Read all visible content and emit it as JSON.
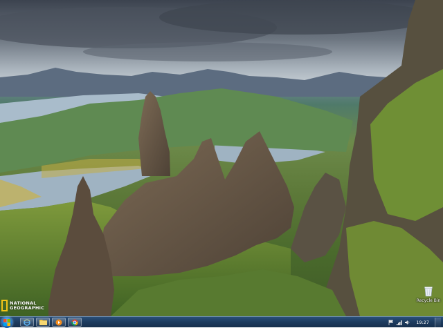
{
  "desktop": {
    "wallpaper": {
      "subject": "rock-pinnacles-landscape",
      "colors": {
        "sky": "#5b6470",
        "loch": "#9fb3c2",
        "grass": "#6d8a3a",
        "rock": "#6a5a48"
      }
    },
    "logo": {
      "line1": "NATIONAL",
      "line2": "GEOGRAPHIC",
      "frame_color": "#f5c518"
    },
    "icons": [
      {
        "label": "Recycle Bin",
        "icon": "recycle-bin-icon"
      }
    ]
  },
  "taskbar": {
    "start_icon": "windows-logo-icon",
    "pinned": [
      {
        "name": "ie",
        "icon": "internet-explorer-icon"
      },
      {
        "name": "explorer",
        "icon": "folder-icon"
      },
      {
        "name": "media",
        "icon": "media-player-icon"
      },
      {
        "name": "chrome",
        "icon": "chrome-icon"
      }
    ],
    "tray": {
      "icons": [
        "flag-icon",
        "network-icon",
        "volume-icon"
      ],
      "clock": "19:27"
    },
    "accent": "#1d3c60"
  }
}
